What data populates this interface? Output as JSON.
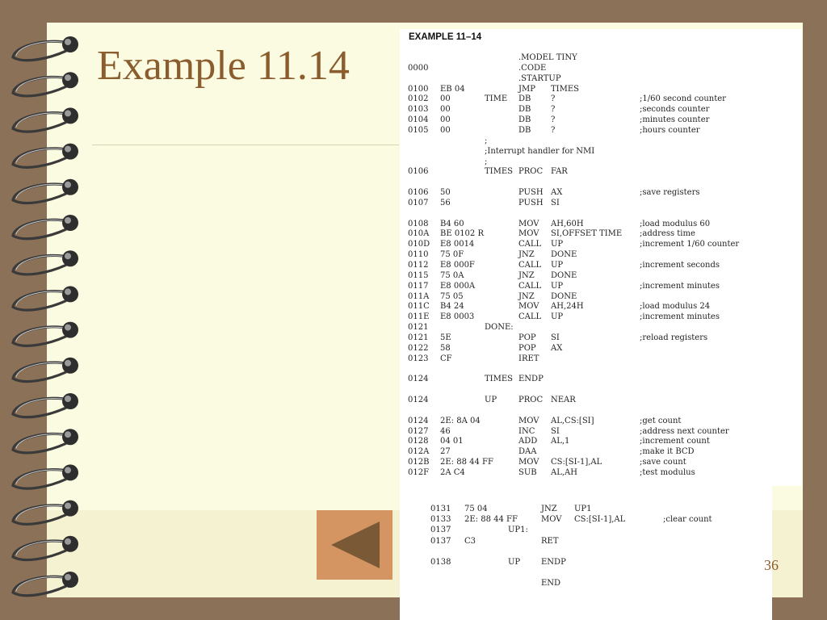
{
  "slide": {
    "title": "Example 11.14",
    "page_number": "36",
    "back_button_label": "Previous slide",
    "colors": {
      "frame": "#8a7157",
      "paper": "#fbfbe1",
      "title": "#8b5c2e",
      "button": "#d49562",
      "arrow": "#7a5a36"
    }
  },
  "listing": {
    "heading": "EXAMPLE 11–14",
    "lines": [
      {
        "addr": "",
        "hex": "",
        "label": "",
        "op": ".MODEL TINY",
        "arg": "",
        "comment": ""
      },
      {
        "addr": "0000",
        "hex": "",
        "label": "",
        "op": ".CODE",
        "arg": "",
        "comment": ""
      },
      {
        "addr": "",
        "hex": "",
        "label": "",
        "op": ".STARTUP",
        "arg": "",
        "comment": ""
      },
      {
        "addr": "0100",
        "hex": "EB 04",
        "label": "",
        "op": "JMP",
        "arg": "TIMES",
        "comment": ""
      },
      {
        "addr": "0102",
        "hex": "00",
        "label": "TIME",
        "op": "DB",
        "arg": "?",
        "comment": ";1/60 second counter"
      },
      {
        "addr": "0103",
        "hex": "00",
        "label": "",
        "op": "DB",
        "arg": "?",
        "comment": ";seconds counter"
      },
      {
        "addr": "0104",
        "hex": "00",
        "label": "",
        "op": "DB",
        "arg": "?",
        "comment": ";minutes counter"
      },
      {
        "addr": "0105",
        "hex": "00",
        "label": "",
        "op": "DB",
        "arg": "?",
        "comment": ";hours counter"
      },
      {
        "addr": "",
        "hex": "",
        "label": ";",
        "op": "",
        "arg": "",
        "comment": ""
      },
      {
        "addr": "",
        "hex": "",
        "label": ";Interrupt handler for NMI",
        "op": "",
        "arg": "",
        "comment": ""
      },
      {
        "addr": "",
        "hex": "",
        "label": ";",
        "op": "",
        "arg": "",
        "comment": ""
      },
      {
        "addr": "0106",
        "hex": "",
        "label": "TIMES",
        "op": "PROC",
        "arg": "FAR",
        "comment": ""
      },
      {
        "addr": "",
        "hex": "",
        "label": "",
        "op": "",
        "arg": "",
        "comment": ""
      },
      {
        "addr": "0106",
        "hex": "50",
        "label": "",
        "op": "PUSH",
        "arg": "AX",
        "comment": ";save registers"
      },
      {
        "addr": "0107",
        "hex": "56",
        "label": "",
        "op": "PUSH",
        "arg": "SI",
        "comment": ""
      },
      {
        "addr": "",
        "hex": "",
        "label": "",
        "op": "",
        "arg": "",
        "comment": ""
      },
      {
        "addr": "0108",
        "hex": "B4 60",
        "label": "",
        "op": "MOV",
        "arg": "AH,60H",
        "comment": ";load modulus 60"
      },
      {
        "addr": "010A",
        "hex": "BE 0102 R",
        "label": "",
        "op": "MOV",
        "arg": "SI,OFFSET TIME",
        "comment": ";address time"
      },
      {
        "addr": "010D",
        "hex": "E8 0014",
        "label": "",
        "op": "CALL",
        "arg": "UP",
        "comment": ";increment 1/60 counter"
      },
      {
        "addr": "0110",
        "hex": "75 0F",
        "label": "",
        "op": "JNZ",
        "arg": "DONE",
        "comment": ""
      },
      {
        "addr": "0112",
        "hex": "E8 000F",
        "label": "",
        "op": "CALL",
        "arg": "UP",
        "comment": ";increment seconds"
      },
      {
        "addr": "0115",
        "hex": "75 0A",
        "label": "",
        "op": "JNZ",
        "arg": "DONE",
        "comment": ""
      },
      {
        "addr": "0117",
        "hex": "E8 000A",
        "label": "",
        "op": "CALL",
        "arg": "UP",
        "comment": ";increment minutes"
      },
      {
        "addr": "011A",
        "hex": "75 05",
        "label": "",
        "op": "JNZ",
        "arg": "DONE",
        "comment": ""
      },
      {
        "addr": "011C",
        "hex": "B4 24",
        "label": "",
        "op": "MOV",
        "arg": "AH,24H",
        "comment": ";load modulus 24"
      },
      {
        "addr": "011E",
        "hex": "E8 0003",
        "label": "",
        "op": "CALL",
        "arg": "UP",
        "comment": ";increment minutes"
      },
      {
        "addr": "0121",
        "hex": "",
        "label": "DONE:",
        "op": "",
        "arg": "",
        "comment": ""
      },
      {
        "addr": "0121",
        "hex": "5E",
        "label": "",
        "op": "POP",
        "arg": "SI",
        "comment": ";reload registers"
      },
      {
        "addr": "0122",
        "hex": "58",
        "label": "",
        "op": "POP",
        "arg": "AX",
        "comment": ""
      },
      {
        "addr": "0123",
        "hex": "CF",
        "label": "",
        "op": "IRET",
        "arg": "",
        "comment": ""
      },
      {
        "addr": "",
        "hex": "",
        "label": "",
        "op": "",
        "arg": "",
        "comment": ""
      },
      {
        "addr": "0124",
        "hex": "",
        "label": "TIMES",
        "op": "ENDP",
        "arg": "",
        "comment": ""
      },
      {
        "addr": "",
        "hex": "",
        "label": "",
        "op": "",
        "arg": "",
        "comment": ""
      },
      {
        "addr": "0124",
        "hex": "",
        "label": "UP",
        "op": "PROC",
        "arg": "NEAR",
        "comment": ""
      },
      {
        "addr": "",
        "hex": "",
        "label": "",
        "op": "",
        "arg": "",
        "comment": ""
      },
      {
        "addr": "0124",
        "hex": "2E: 8A 04",
        "label": "",
        "op": "MOV",
        "arg": "AL,CS:[SI]",
        "comment": ";get count"
      },
      {
        "addr": "0127",
        "hex": "46",
        "label": "",
        "op": "INC",
        "arg": "SI",
        "comment": ";address next counter"
      },
      {
        "addr": "0128",
        "hex": "04 01",
        "label": "",
        "op": "ADD",
        "arg": "AL,1",
        "comment": ";increment count"
      },
      {
        "addr": "012A",
        "hex": "27",
        "label": "",
        "op": "DAA",
        "arg": "",
        "comment": ";make it BCD"
      },
      {
        "addr": "012B",
        "hex": "2E: 88 44 FF",
        "label": "",
        "op": "MOV",
        "arg": "CS:[SI-1],AL",
        "comment": ";save count"
      },
      {
        "addr": "012F",
        "hex": "2A C4",
        "label": "",
        "op": "SUB",
        "arg": "AL,AH",
        "comment": ";test modulus"
      }
    ]
  },
  "listing_continued": {
    "lines": [
      {
        "addr": "0131",
        "hex": "75 04",
        "label": "",
        "op": "JNZ",
        "arg": "UP1",
        "comment": ""
      },
      {
        "addr": "0133",
        "hex": "2E: 88 44 FF",
        "label": "",
        "op": "MOV",
        "arg": "CS:[SI-1],AL",
        "comment": ";clear count"
      },
      {
        "addr": "0137",
        "hex": "",
        "label": "UP1:",
        "op": "",
        "arg": "",
        "comment": ""
      },
      {
        "addr": "0137",
        "hex": "C3",
        "label": "",
        "op": "RET",
        "arg": "",
        "comment": ""
      },
      {
        "addr": "",
        "hex": "",
        "label": "",
        "op": "",
        "arg": "",
        "comment": ""
      },
      {
        "addr": "0138",
        "hex": "",
        "label": "UP",
        "op": "ENDP",
        "arg": "",
        "comment": ""
      },
      {
        "addr": "",
        "hex": "",
        "label": "",
        "op": "",
        "arg": "",
        "comment": ""
      },
      {
        "addr": "",
        "hex": "",
        "label": "",
        "op": "END",
        "arg": "",
        "comment": ""
      }
    ]
  }
}
